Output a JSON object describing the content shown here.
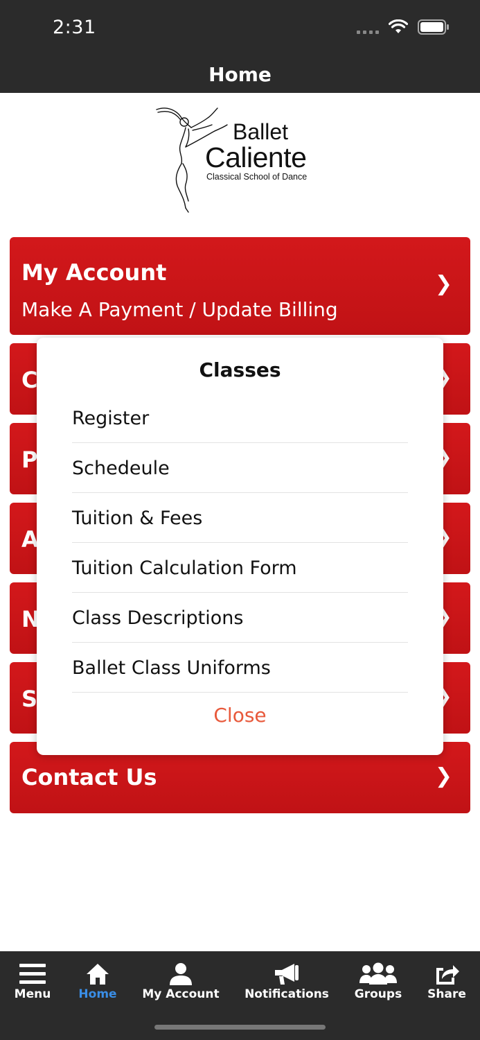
{
  "status": {
    "time": "2:31"
  },
  "header": {
    "title": "Home"
  },
  "logo": {
    "line1": "Ballet",
    "line2": "Caliente",
    "tagline": "Classical School of Dance"
  },
  "menu": {
    "chevron": "❯",
    "my_account": {
      "label": "My Account",
      "sub": "Make A Payment / Update Billing"
    },
    "partial_letters": [
      "C",
      "P",
      "A",
      "N",
      "S"
    ],
    "contact": {
      "label": "Contact Us"
    }
  },
  "modal": {
    "title": "Classes",
    "items": [
      "Register",
      "Schedeule",
      "Tuition & Fees",
      "Tuition Calculation Form",
      "Class Descriptions",
      "Ballet Class Uniforms"
    ],
    "close": "Close"
  },
  "tabs": [
    {
      "label": "Menu",
      "icon": "menu-icon"
    },
    {
      "label": "Home",
      "icon": "home-icon",
      "active": true
    },
    {
      "label": "My Account",
      "icon": "user-icon"
    },
    {
      "label": "Notifications",
      "icon": "megaphone-icon"
    },
    {
      "label": "Groups",
      "icon": "groups-icon"
    },
    {
      "label": "Share",
      "icon": "share-icon"
    }
  ],
  "colors": {
    "button_red": "#c8161a",
    "bar_dark": "#2b2b2b",
    "active_tab": "#3a8ee6",
    "close_text": "#e8593b"
  }
}
